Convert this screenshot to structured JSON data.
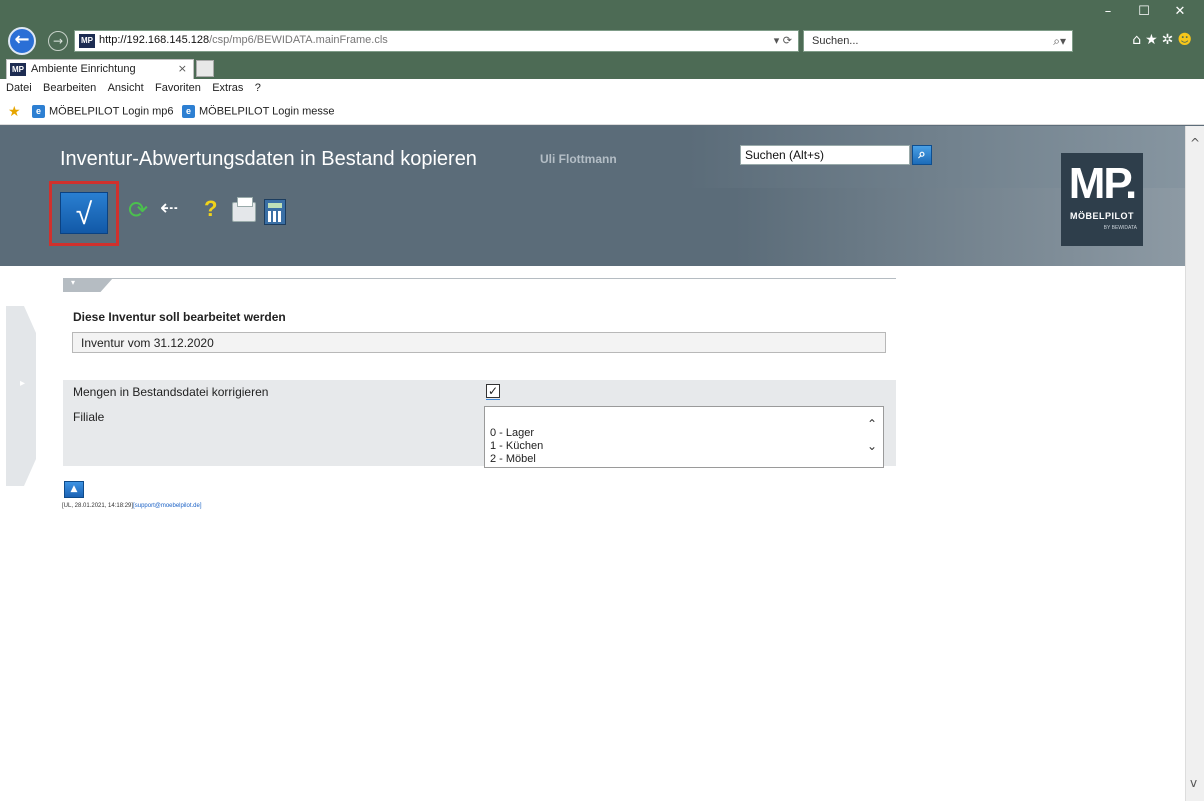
{
  "browser": {
    "url_host": "http://192.168.145.128",
    "url_path": "/csp/mp6/BEWIDATA.mainFrame.cls",
    "url_tools": "▾ ⟳",
    "search_placeholder": "Suchen...",
    "search_tools": "⌕▾",
    "favicon_text": "MP",
    "tab_title": "Ambiente Einrichtung",
    "tab_close": "×",
    "window_controls": [
      "–",
      "☐",
      "✕"
    ],
    "toolbar_icons": [
      "home-icon",
      "star-icon",
      "gear-icon",
      "smiley-icon"
    ]
  },
  "menu": [
    "Datei",
    "Bearbeiten",
    "Ansicht",
    "Favoriten",
    "Extras",
    "?"
  ],
  "favorites": [
    {
      "label": "MÖBELPILOT Login mp6"
    },
    {
      "label": "MÖBELPILOT Login messe"
    }
  ],
  "app": {
    "title": "Inventur-Abwertungsdaten in Bestand kopieren",
    "user": "Uli Flottmann",
    "search_value": "Suchen (Alt+s)",
    "logo": {
      "mark": "MP.",
      "name": "MÖBELPILOT",
      "sub": "BY BEWIDATA"
    },
    "toolbar": {
      "confirm": "√",
      "refresh": "⟳",
      "back": "⇠",
      "help": "?"
    },
    "form": {
      "section_label": "Diese Inventur soll bearbeitet werden",
      "inventur_value": "Inventur vom 31.12.2020",
      "mengen_label": "Mengen in Bestandsdatei korrigieren",
      "mengen_checked": true,
      "filiale_label": "Filiale",
      "filiale_options": [
        "0 - Lager",
        "1 - Küchen",
        "2 - Möbel"
      ]
    },
    "footer": {
      "meta": "[UL, 28.01.2021, 14:18:29]",
      "email": "[support@moebelpilot.de]"
    }
  },
  "colors": {
    "header": "#5b6c79",
    "accent": "#1c6bb8",
    "highlight": "#d0312d",
    "browser_chrome": "#4d6b55"
  }
}
